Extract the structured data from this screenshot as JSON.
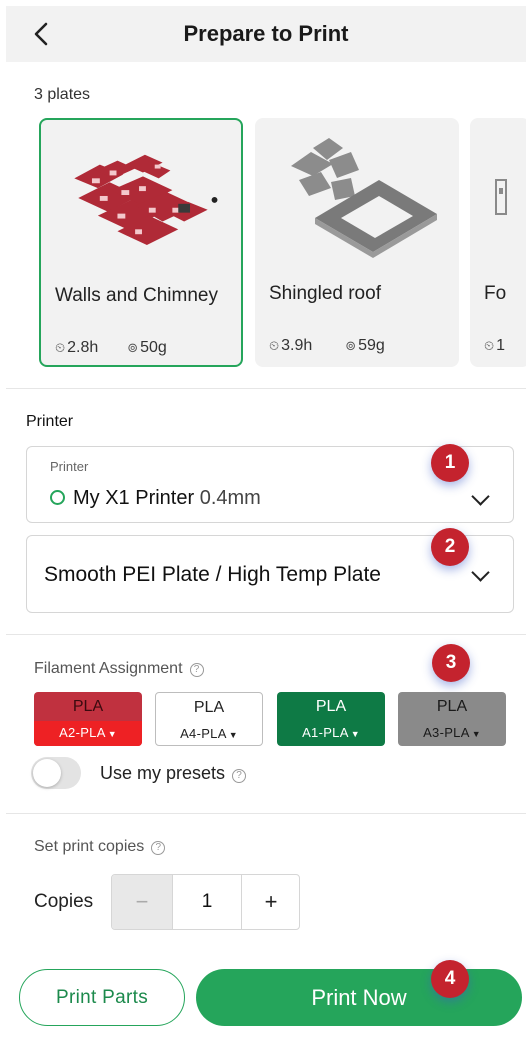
{
  "header": {
    "title": "Prepare to Print"
  },
  "plates": {
    "count_label": "3 plates",
    "items": [
      {
        "name": "Walls and Chimney",
        "time": "2.8h",
        "weight": "50g",
        "selected": true
      },
      {
        "name": "Shingled roof",
        "time": "3.9h",
        "weight": "59g",
        "selected": false
      },
      {
        "name": "Fo",
        "time": "1",
        "weight": "",
        "selected": false
      }
    ]
  },
  "printer": {
    "section_label": "Printer",
    "field_label": "Printer",
    "name": "My X1 Printer",
    "nozzle": "0.4mm",
    "status_color": "#25a55b",
    "plate_type": "Smooth PEI Plate / High Temp Plate"
  },
  "filament": {
    "label": "Filament Assignment",
    "items": [
      {
        "type": "PLA",
        "slot": "A2-PLA",
        "top_color": "#c0313f",
        "bottom_color": "#ee2124"
      },
      {
        "type": "PLA",
        "slot": "A4-PLA",
        "top_color": "#ffffff",
        "bottom_color": "#ffffff"
      },
      {
        "type": "PLA",
        "slot": "A1-PLA",
        "top_color": "#0e7a45",
        "bottom_color": "#0e7a45"
      },
      {
        "type": "PLA",
        "slot": "A3-PLA",
        "top_color": "#8a8a8a",
        "bottom_color": "#8a8a8a"
      }
    ],
    "use_presets_label": "Use my presets",
    "use_presets_on": false
  },
  "copies": {
    "section_label": "Set print copies",
    "label": "Copies",
    "value": "1",
    "minus": "−",
    "plus": "+"
  },
  "badges": [
    "1",
    "2",
    "3",
    "4"
  ],
  "actions": {
    "print_parts": "Print Parts",
    "print_now": "Print Now"
  },
  "colors": {
    "accent": "#25a55b",
    "badge": "#c4232e"
  }
}
